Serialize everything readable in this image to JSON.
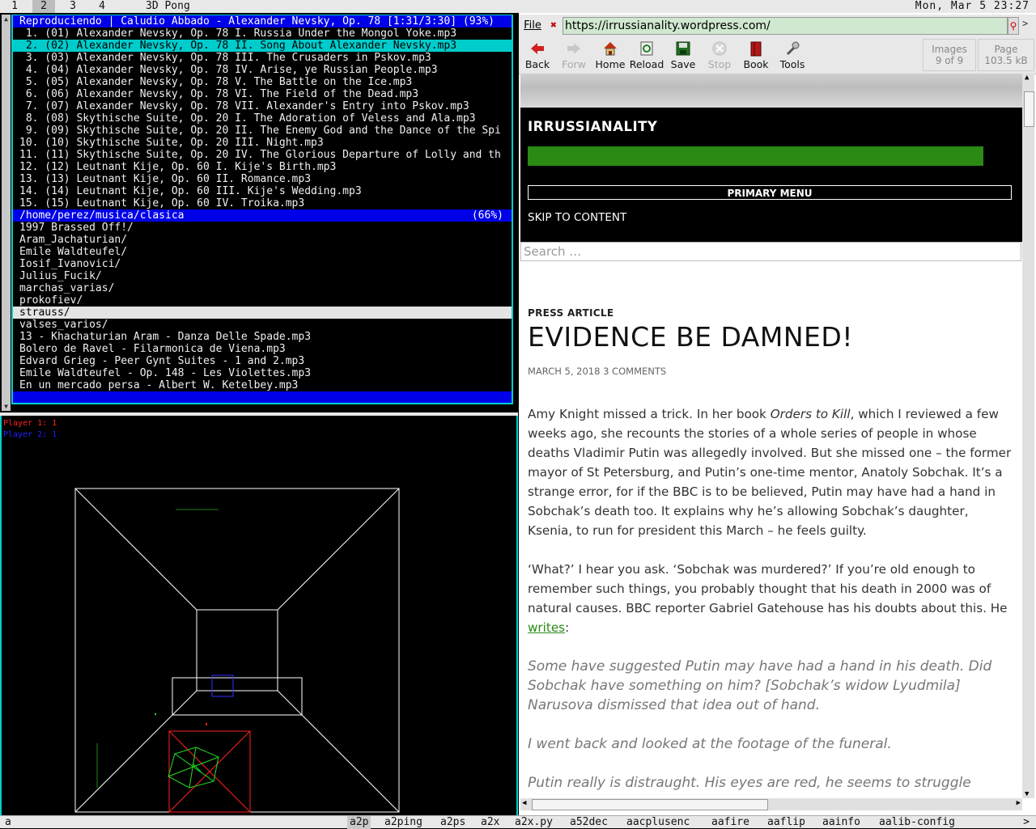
{
  "topbar": {
    "workspaces": [
      "1",
      "2",
      "3",
      "4"
    ],
    "active_workspace": "2",
    "window_title": "3D Pong",
    "clock": "Mon, Mar  5 23:27"
  },
  "player": {
    "header": "Reproduciendo | Caludio Abbado - Alexander Nevsky, Op. 78 [1:31/3:30] (93%)",
    "tracks": [
      " 1. (01) Alexander Nevsky, Op. 78 I. Russia Under the Mongol Yoke.mp3",
      " 2. (02) Alexander Nevsky, Op. 78 II. Song About Alexander Nevsky.mp3",
      " 3. (03) Alexander Nevsky, Op. 78 III. The Crusaders in Pskov.mp3",
      " 4. (04) Alexander Nevsky, Op. 78 IV. Arise, ye Russian People.mp3",
      " 5. (05) Alexander Nevsky, Op. 78 V. The Battle on the Ice.mp3",
      " 6. (06) Alexander Nevsky, Op. 78 VI. The Field of the Dead.mp3",
      " 7. (07) Alexander Nevsky, Op. 78 VII. Alexander's Entry into Pskov.mp3",
      " 8. (08) Skythische Suite, Op. 20 I. The Adoration of Veless and Ala.mp3",
      " 9. (09) Skythische Suite, Op. 20 II. The Enemy God and the Dance of the Spi",
      "10. (10) Skythische Suite, Op. 20 III. Night.mp3",
      "11. (11) Skythische Suite, Op. 20 IV. The Glorious Departure of Lolly and th",
      "12. (12) Leutnant Kije, Op. 60 I. Kije's Birth.mp3",
      "13. (13) Leutnant Kije, Op. 60 II. Romance.mp3",
      "14. (14) Leutnant Kije, Op. 60 III. Kije's Wedding.mp3",
      "15. (15) Leutnant Kije, Op. 60 IV. Troika.mp3"
    ],
    "current_track_index": 1,
    "dir_path": "/home/perez/musica/clasica",
    "dir_percent": "(66%)",
    "dir_entries": [
      "1997 Brassed Off!/",
      "Aram_Jachaturian/",
      "Emile Waldteufel/",
      "Iosif_Ivanovici/",
      "Julius_Fucik/",
      "marchas_varias/",
      "prokofiev/",
      "strauss/",
      "valses_varios/",
      "13 - Khachaturian Aram - Danza Delle Spade.mp3",
      "Bolero de Ravel - Filarmonica de Viena.mp3",
      "Edvard Grieg - Peer Gynt Suites - 1 and 2.mp3",
      "Emile Waldteufel - Op. 148 - Les Violettes.mp3",
      "En un mercado persa - Albert W. Ketelbey.mp3"
    ],
    "selected_dir_index": 7,
    "colors": {
      "header_bg": "#0000e8",
      "current_bg": "#00cccc",
      "border": "#00d0d0"
    }
  },
  "pong": {
    "player1": "Player 1: 1",
    "player2": "Player 2: 1",
    "player1_color": "#ff2020",
    "player2_color": "#2020ff"
  },
  "browser": {
    "file_menu": "File",
    "url": "https://irrussianality.wordpress.com/",
    "toolbar": {
      "back": "Back",
      "forward": "Forw",
      "home": "Home",
      "reload": "Reload",
      "save": "Save",
      "stop": "Stop",
      "book": "Book",
      "tools": "Tools"
    },
    "images_label": "Images",
    "images_count": "9 of 9",
    "page_label": "Page",
    "page_size": "103.5 kB",
    "page": {
      "site_title": "IRRUSSIANALITY",
      "primary_menu": "PRIMARY MENU",
      "skip_to_content": "SKIP TO CONTENT",
      "search_placeholder": "Search …",
      "category": "PRESS ARTICLE",
      "post_title": "EVIDENCE BE DAMNED!",
      "post_meta": "MARCH 5, 2018 3 COMMENTS",
      "para1_before": "Amy Knight missed a trick. In her book ",
      "para1_book": "Orders to Kill",
      "para1_after": ", which I reviewed a few weeks ago, she recounts the stories of a whole series of people in whose deaths Vladimir Putin was allegedly involved. But she missed one – the former mayor of St Petersburg, and Putin’s one-time mentor, Anatoly Sobchak. It’s a strange error, for if the BBC is to be believed, Putin may have had a hand in Sobchak’s death too. It explains why he’s allowing Sobchak’s daughter, Ksenia, to run for president this March – he feels guilty.",
      "para2_before": "‘What?’ I hear you ask. ‘Sobchak was murdered?’ If you’re old enough to remember such things, you probably thought that his death in 2000 was of natural causes. BBC reporter Gabriel Gatehouse has his doubts about this. He ",
      "para2_link": "writes",
      "para2_after": ":",
      "quote1": "Some have suggested Putin may have had a hand in his death. Did Sobchak have something on him? [Sobchak’s widow Lyudmila] Narusova dismissed that idea out of hand.",
      "quote2": "I went back and looked at the footage of the funeral.",
      "quote3": "Putin really is distraught. His eyes are red, he seems to struggle",
      "colors": {
        "header_bg": "#000000",
        "accent": "#2a8a14",
        "url_bg": "#cfe8cf"
      }
    }
  },
  "taskbar": {
    "prompt": "a",
    "items": [
      "a2p",
      "a2ping",
      "a2ps",
      "a2x",
      "a2x.py",
      "a52dec",
      "aacplusenc",
      "aafire",
      "aaflip",
      "aainfo",
      "aalib-config"
    ],
    "active_item": "a2p",
    "more_arrow": ">"
  }
}
